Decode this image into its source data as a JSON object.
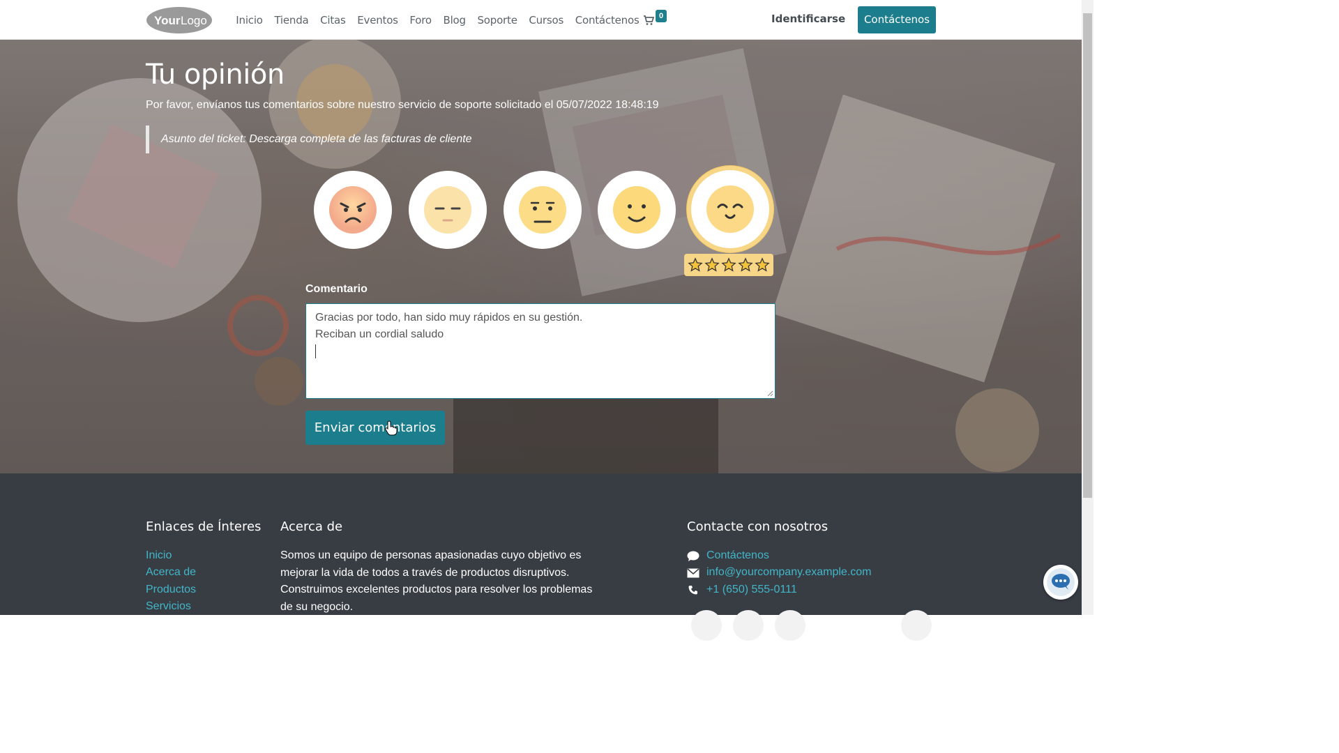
{
  "header": {
    "logo_text": "YourLogo",
    "nav": [
      "Inicio",
      "Tienda",
      "Citas",
      "Eventos",
      "Foro",
      "Blog",
      "Soporte",
      "Cursos",
      "Contáctenos"
    ],
    "cart_count": "0",
    "login_label": "Identificarse",
    "contact_button": "Contáctenos"
  },
  "hero": {
    "title": "Tu opinión",
    "subtitle": "Por favor, envíanos tus comentarios sobre nuestro servicio de soporte solicitado el 05/07/2022 18:48:19",
    "ticket_subject": "Asunto del ticket: Descarga completa de las facturas de cliente",
    "rating_faces": [
      "angry-face-icon",
      "unamused-face-icon",
      "neutral-face-icon",
      "smiling-face-icon",
      "happy-face-icon"
    ],
    "selected_rating": 5,
    "max_rating": 5,
    "comment_label": "Comentario",
    "comment_lines": [
      "Gracias por todo, han sido muy rápidos en su gestión.",
      "Reciban un cordial saludo"
    ],
    "submit_label": "Enviar comentarios"
  },
  "footer": {
    "links_title": "Enlaces de Ínteres",
    "links": [
      "Inicio",
      "Acerca de",
      "Productos",
      "Servicios"
    ],
    "about_title": "Acerca de",
    "about_text": "Somos un equipo de personas apasionadas cuyo objetivo es mejorar la vida de todos a través de productos disruptivos. Construimos excelentes productos para resolver los problemas de su negocio.",
    "contact_title": "Contacte con nosotros",
    "contact_link": "Contáctenos",
    "email": "info@yourcompany.example.com",
    "phone": "+1 (650) 555-0111"
  },
  "colors": {
    "brand": "#1c7d8d",
    "link": "#42b6c9",
    "footer_bg": "#383d44",
    "rating_highlight": "#f7d687"
  }
}
